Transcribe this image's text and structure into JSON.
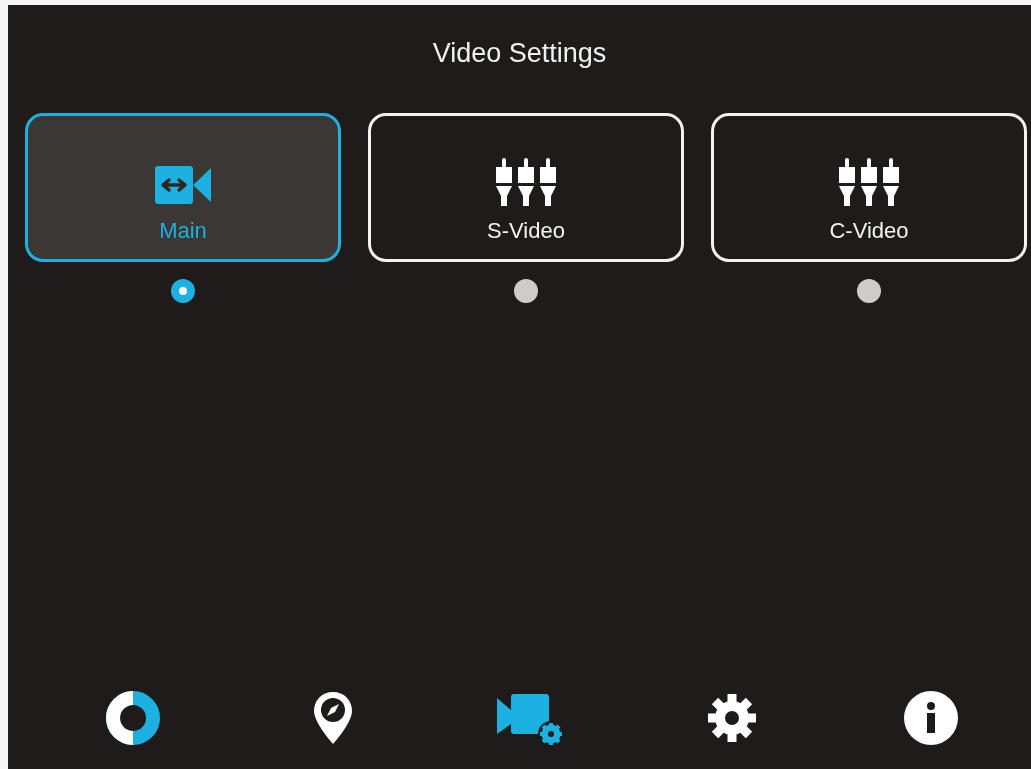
{
  "title": "Video Settings",
  "sources": [
    {
      "label": "Main",
      "kind": "camera",
      "selected": true
    },
    {
      "label": "S-Video",
      "kind": "plugs",
      "selected": false
    },
    {
      "label": "C-Video",
      "kind": "plugs",
      "selected": false
    }
  ],
  "nav": [
    {
      "kind": "ring",
      "selected": false
    },
    {
      "kind": "compass",
      "selected": false
    },
    {
      "kind": "video",
      "selected": true
    },
    {
      "kind": "gear",
      "selected": false
    },
    {
      "kind": "info",
      "selected": false
    }
  ]
}
